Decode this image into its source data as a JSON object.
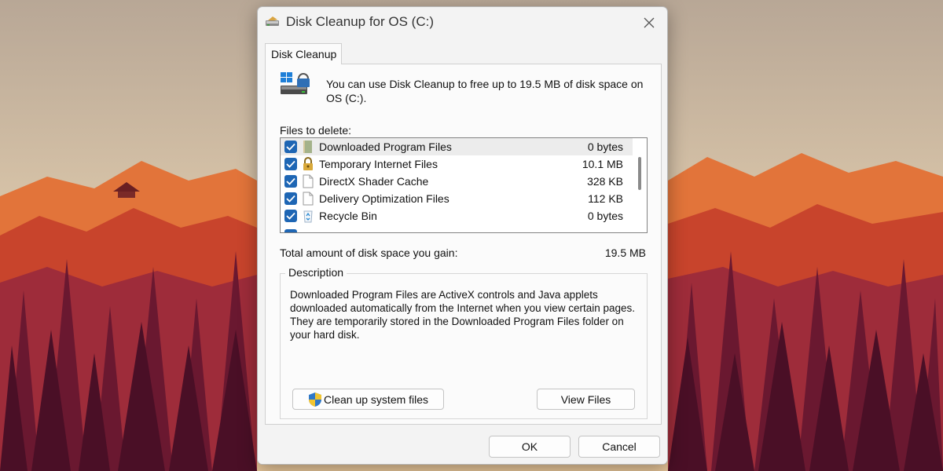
{
  "window": {
    "title": "Disk Cleanup for OS (C:)",
    "close_icon": "close-icon"
  },
  "tab": {
    "label": "Disk Cleanup"
  },
  "info": {
    "message": "You can use Disk Cleanup to free up to 19.5 MB of disk space on OS (C:)."
  },
  "files": {
    "label": "Files to delete:",
    "items": [
      {
        "name": "Downloaded Program Files",
        "size": "0 bytes",
        "checked": true,
        "selected": true,
        "icon": "folder-icon"
      },
      {
        "name": "Temporary Internet Files",
        "size": "10.1 MB",
        "checked": true,
        "selected": false,
        "icon": "lock-icon"
      },
      {
        "name": "DirectX Shader Cache",
        "size": "328 KB",
        "checked": true,
        "selected": false,
        "icon": "document-icon"
      },
      {
        "name": "Delivery Optimization Files",
        "size": "112 KB",
        "checked": true,
        "selected": false,
        "icon": "document-icon"
      },
      {
        "name": "Recycle Bin",
        "size": "0 bytes",
        "checked": true,
        "selected": false,
        "icon": "recycle-bin-icon"
      }
    ]
  },
  "total": {
    "label": "Total amount of disk space you gain:",
    "value": "19.5 MB"
  },
  "description": {
    "legend": "Description",
    "text": "Downloaded Program Files are ActiveX controls and Java applets downloaded automatically from the Internet when you view certain pages. They are temporarily stored in the Downloaded Program Files folder on your hard disk."
  },
  "buttons": {
    "cleanup_system": "Clean up system files",
    "view_files": "View Files",
    "ok": "OK",
    "cancel": "Cancel"
  },
  "colors": {
    "checkbox": "#1e66b4",
    "dialog_bg": "#f3f3f3",
    "panel_bg": "#fbfbfb"
  }
}
